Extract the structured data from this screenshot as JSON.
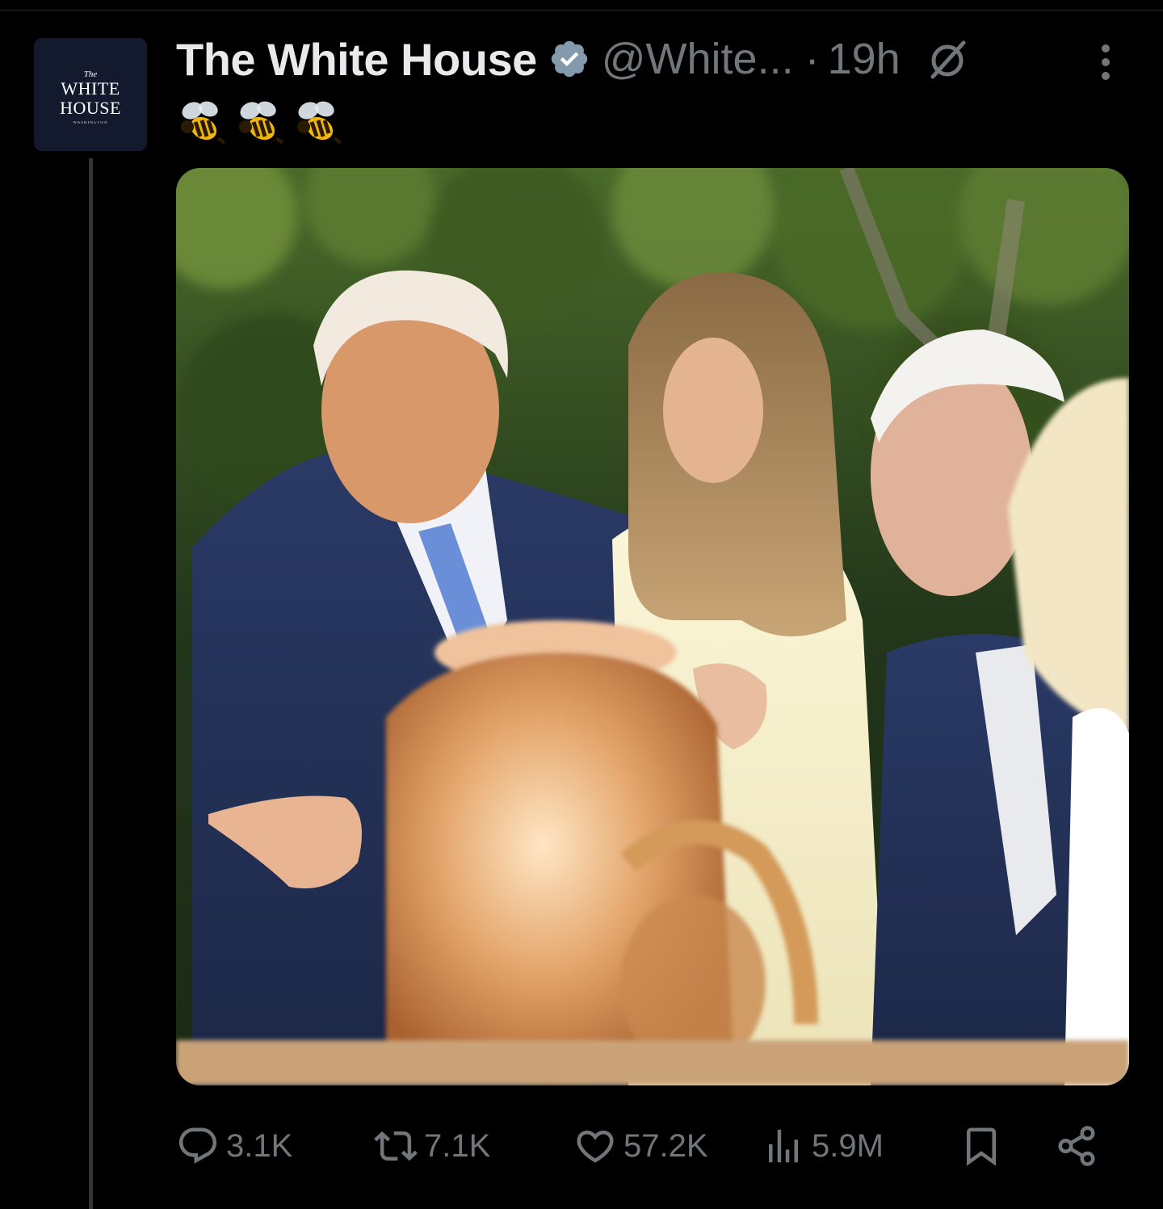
{
  "author": {
    "display_name": "The White House",
    "handle": "@White...",
    "separator": "·",
    "time": "19h",
    "avatar": {
      "line_the": "The",
      "line_1": "WHITE",
      "line_2": "HOUSE",
      "line_small": "WASHINGTON"
    }
  },
  "tweet": {
    "text_emojis": [
      "bee-emoji",
      "bee-emoji",
      "bee-emoji"
    ]
  },
  "media": {
    "alt": "photo"
  },
  "actions": {
    "reply_count": "3.1K",
    "repost_count": "7.1K",
    "like_count": "57.2K",
    "views_count": "5.9M"
  },
  "colors": {
    "background": "#000000",
    "text_primary": "#e7e9ea",
    "text_secondary": "#71767b",
    "verified_badge": "#829aab",
    "divider": "#2f3336"
  },
  "icons": {
    "verified": "verified-badge-icon",
    "grok": "grok-icon",
    "more": "more-vertical-icon",
    "reply": "reply-icon",
    "repost": "repost-icon",
    "like": "heart-icon",
    "views": "views-icon",
    "bookmark": "bookmark-icon",
    "share": "share-icon"
  }
}
